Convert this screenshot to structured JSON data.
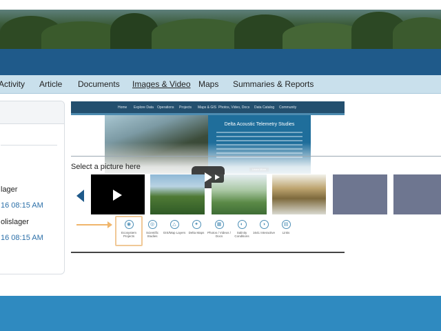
{
  "nav": {
    "items": [
      {
        "label": "Activity",
        "active": false
      },
      {
        "label": "Article",
        "active": false
      },
      {
        "label": "Documents",
        "active": false
      },
      {
        "label": "Images & Video",
        "active": true
      },
      {
        "label": "Maps",
        "active": false
      },
      {
        "label": "Summaries & Reports",
        "active": false
      }
    ]
  },
  "sidebar": {
    "entries": [
      {
        "name": "lager",
        "time": "16 08:15 AM"
      },
      {
        "name": "olislager",
        "time": "16 08:15 AM"
      }
    ]
  },
  "video": {
    "site_nav": [
      "Home",
      "Explore Data",
      "Operations",
      "Projects",
      "Maps & GIS",
      "Photos, Video, Docs",
      "Data Catalog",
      "Community"
    ],
    "hero_title": "Delta Acoustic Telemetry Studies",
    "hero_button": "Learn More",
    "select_prompt": "Select a picture here",
    "icons": [
      {
        "label": "Ecosystem Projects"
      },
      {
        "label": "Scientific Studies"
      },
      {
        "label": "GIS/Map Layers"
      },
      {
        "label": "Delta Maps"
      },
      {
        "label": "Photos / Videos / Docs"
      },
      {
        "label": "Salinity Conditions"
      },
      {
        "label": "1641 Interactive"
      },
      {
        "label": "Links"
      }
    ]
  },
  "colors": {
    "primary_blue": "#1f5a8a",
    "nav_bg": "#c9e0ec",
    "footer_blue": "#2f8ac0",
    "link_blue": "#2b6fa8"
  }
}
